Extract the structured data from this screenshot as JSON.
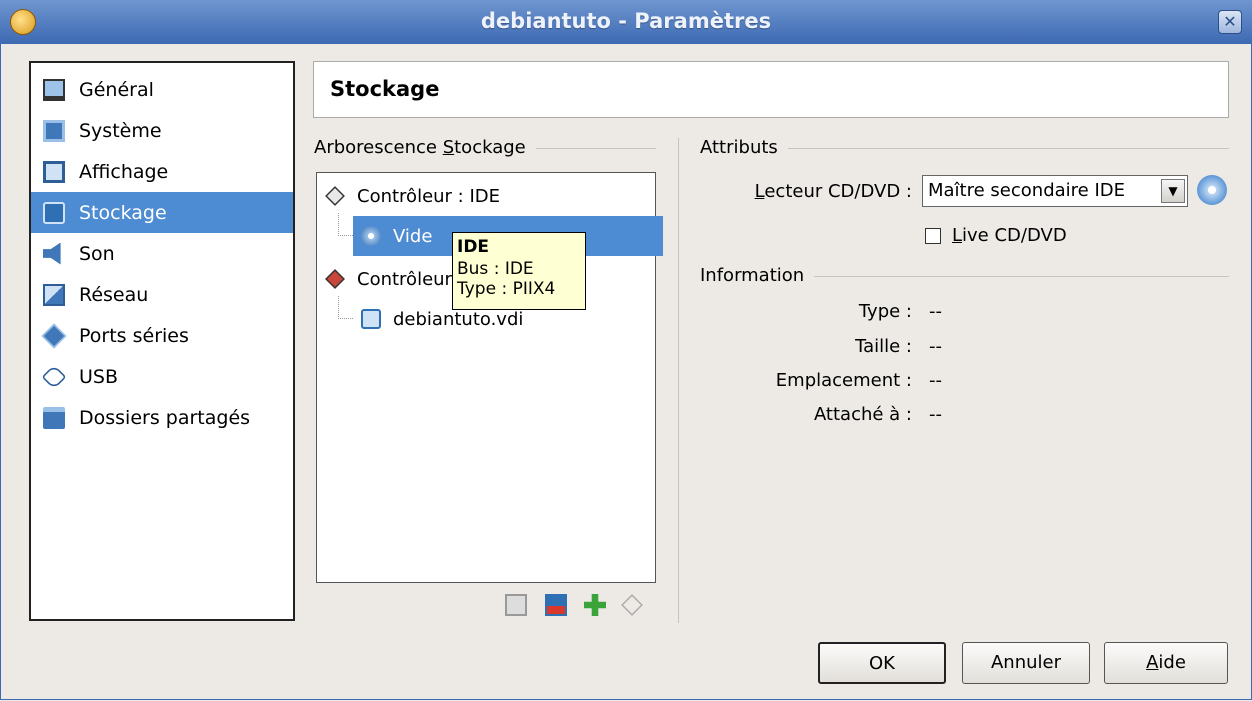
{
  "window": {
    "title": "debiantuto - Paramètres"
  },
  "sidebar": {
    "items": [
      {
        "label": "Général",
        "icon": "monitor-icon"
      },
      {
        "label": "Système",
        "icon": "chip-icon"
      },
      {
        "label": "Affichage",
        "icon": "display-icon"
      },
      {
        "label": "Stockage",
        "icon": "hard-disk-icon",
        "selected": true
      },
      {
        "label": "Son",
        "icon": "speaker-icon"
      },
      {
        "label": "Réseau",
        "icon": "network-icon"
      },
      {
        "label": "Ports séries",
        "icon": "serial-port-icon"
      },
      {
        "label": "USB",
        "icon": "usb-icon"
      },
      {
        "label": "Dossiers partagés",
        "icon": "folder-icon"
      }
    ]
  },
  "page": {
    "heading": "Stockage"
  },
  "storage_tree": {
    "group_label_prefix": "Arborescence ",
    "group_label_mnemonic": "S",
    "group_label_rest": "tockage",
    "rows": [
      {
        "label": "Contrôleur : IDE",
        "icon": "ide-controller-icon"
      },
      {
        "label": "Vide",
        "icon": "cd-icon",
        "selected": true
      },
      {
        "label": "Contrôleur : SATA",
        "icon": "sata-controller-icon"
      },
      {
        "label": "debiantuto.vdi",
        "icon": "hard-disk-icon"
      }
    ]
  },
  "tooltip": {
    "title": "IDE",
    "bus": "Bus :  IDE",
    "type": "Type :  PIIX4"
  },
  "toolbar": {
    "icons": [
      "add-attachment-icon",
      "remove-attachment-icon",
      "add-controller-icon",
      "remove-controller-icon"
    ]
  },
  "attributes": {
    "group_label": "Attributs",
    "cd_drive_label_mnemonic": "L",
    "cd_drive_label_rest": "ecteur CD/DVD :",
    "cd_drive_value": "Maître secondaire IDE",
    "live_cd_mnemonic": "L",
    "live_cd_rest": "ive CD/DVD",
    "live_cd_checked": false
  },
  "information": {
    "group_label": "Information",
    "rows": [
      {
        "label": "Type :",
        "value": "--"
      },
      {
        "label": "Taille :",
        "value": "--"
      },
      {
        "label": "Emplacement :",
        "value": "--"
      },
      {
        "label": "Attaché à :",
        "value": "--"
      }
    ]
  },
  "buttons": {
    "ok": "OK",
    "cancel": "Annuler",
    "help_mnemonic": "A",
    "help_rest": "ide"
  },
  "colors": {
    "selection": "#4d8bd2",
    "titlebar": "#3d6ab3",
    "background": "#edeae6"
  }
}
